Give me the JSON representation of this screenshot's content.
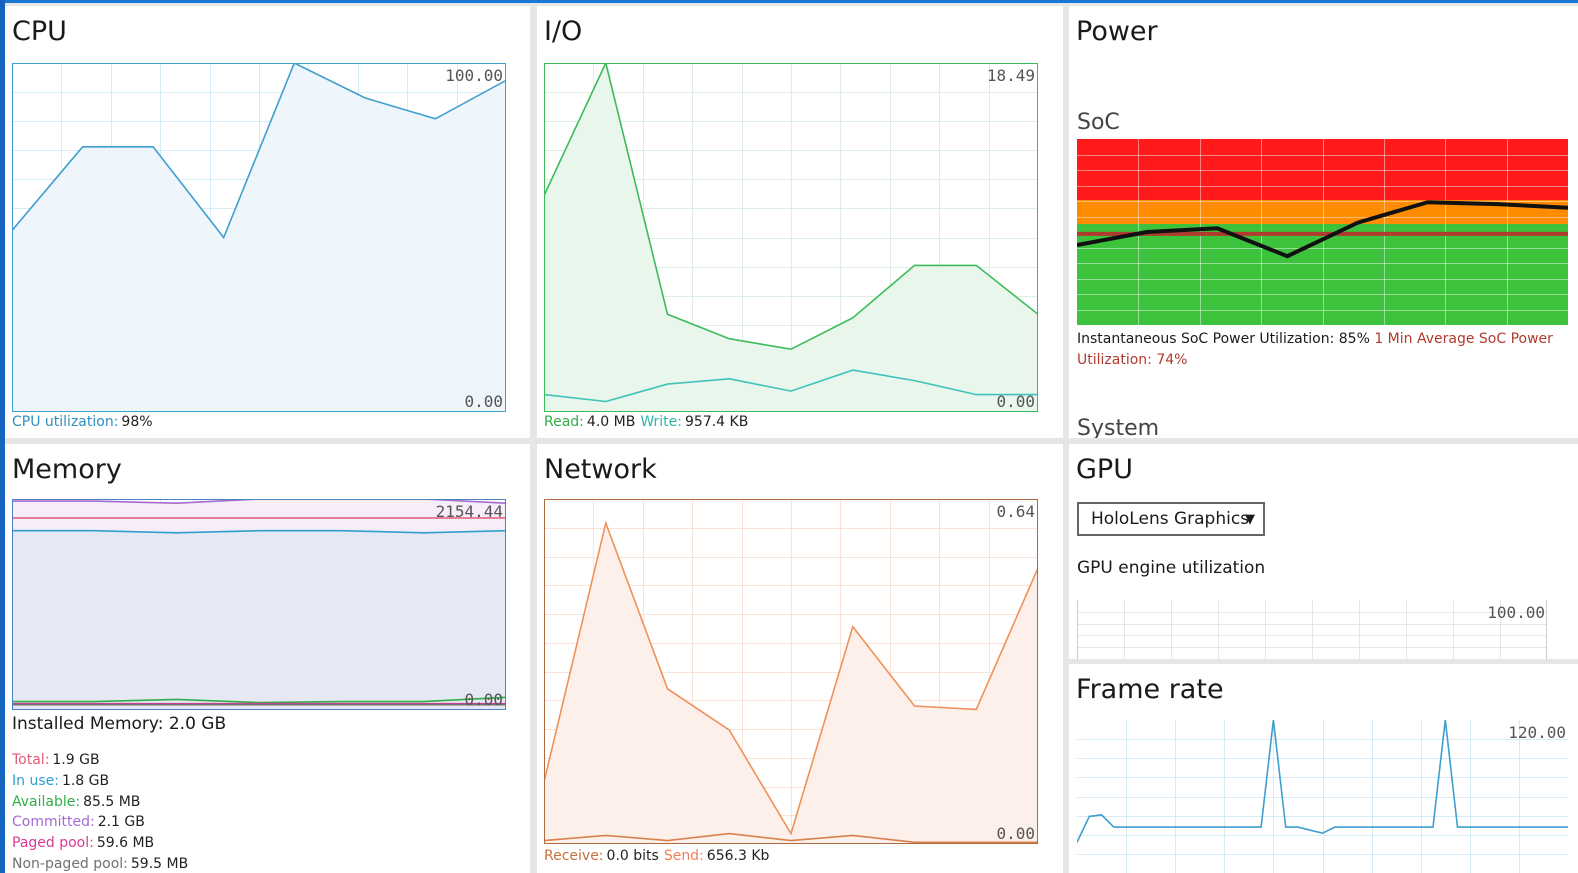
{
  "panels": {
    "cpu": {
      "title": "CPU",
      "max": "100.00",
      "min": "0.00",
      "legend_key": "CPU utilization:",
      "legend_value": "98%",
      "series": [
        {
          "name": "CPU utilization",
          "color": "#3f9fcf",
          "fill": "#eef5fb",
          "values": [
            52,
            76,
            76,
            50,
            100,
            90,
            84,
            95
          ]
        }
      ]
    },
    "io": {
      "title": "I/O",
      "max": "18.49",
      "min": "0.00",
      "read_key": "Read:",
      "read_value": "4.0 MB",
      "write_key": "Write:",
      "write_value": "957.4 KB",
      "series": [
        {
          "name": "Read",
          "color": "#3dbb5a",
          "fill": "#e8f6ec",
          "values": [
            62,
            100,
            28,
            21,
            18,
            27,
            42,
            42,
            28
          ]
        },
        {
          "name": "Write",
          "color": "#3fc3b9",
          "fill": "none",
          "values": [
            5,
            3,
            8,
            9.5,
            6,
            12,
            9,
            5,
            5
          ]
        }
      ]
    },
    "memory": {
      "title": "Memory",
      "max": "2154.44",
      "min": "0.00",
      "installed": "Installed Memory: 2.0 GB",
      "items": [
        {
          "key": "Total:",
          "value": "1.9 GB",
          "color": "#e05a78"
        },
        {
          "key": "In use:",
          "value": "1.8 GB",
          "color": "#2f9fcf"
        },
        {
          "key": "Available:",
          "value": "85.5 MB",
          "color": "#2fae4a"
        },
        {
          "key": "Committed:",
          "value": "2.1 GB",
          "color": "#a56bd1"
        },
        {
          "key": "Paged pool:",
          "value": "59.6 MB",
          "color": "#d63b93"
        },
        {
          "key": "Non-paged pool:",
          "value": "59.5 MB",
          "color": "#707070"
        }
      ],
      "series": [
        {
          "name": "Committed",
          "color": "#a56bd1",
          "values": [
            99,
            99,
            98,
            100,
            100,
            100,
            98
          ]
        },
        {
          "name": "Total",
          "color": "#e05a78",
          "values": [
            91,
            91,
            91,
            91,
            91,
            91,
            91
          ]
        },
        {
          "name": "In use",
          "color": "#2f9fcf",
          "values": [
            85,
            85,
            84,
            85,
            85,
            84,
            85
          ]
        },
        {
          "name": "Available",
          "color": "#2fae4a",
          "values": [
            4,
            4,
            5,
            3.5,
            4,
            4,
            6
          ]
        },
        {
          "name": "Paged pool",
          "color": "#d63b93",
          "values": [
            3,
            3,
            3,
            3,
            3,
            3,
            3
          ]
        },
        {
          "name": "Non-paged pool",
          "color": "#707070",
          "values": [
            2.5,
            2.5,
            2.5,
            2.5,
            2.5,
            2.5,
            2.5
          ]
        }
      ]
    },
    "network": {
      "title": "Network",
      "max": "0.64",
      "min": "0.00",
      "receive_key": "Receive:",
      "receive_value": "0.0 bits",
      "send_key": "Send:",
      "send_value": "656.3 Kb",
      "series": [
        {
          "name": "Send",
          "color": "#f0905a",
          "fill": "#fdf0ea",
          "values": [
            18,
            93,
            45,
            33,
            3,
            63,
            40,
            39,
            80
          ]
        },
        {
          "name": "Receive",
          "color": "#d9804f",
          "fill": "none",
          "values": [
            1,
            2.5,
            1,
            3,
            1,
            2.5,
            0.5,
            0.5,
            0.5
          ]
        }
      ]
    },
    "power": {
      "title": "Power",
      "soc_title": "SoC",
      "instant_text": "Instantaneous SoC Power Utilization: 85%",
      "avg_text": "1 Min Average SoC Power Utilization: 74%",
      "system_title": "System",
      "bands": {
        "red": "#ff1a1a",
        "orange": "#ff8c00",
        "green": "#3cc23c",
        "avg_line": "#b03a2e"
      },
      "series": [
        {
          "name": "SoC Power",
          "color": "#111111",
          "values": [
            43,
            50,
            52,
            37,
            55,
            66,
            65,
            63
          ]
        }
      ],
      "avg_value": 49
    },
    "gpu": {
      "title": "GPU",
      "selected": "HoloLens Graphics",
      "engine_title": "GPU engine utilization",
      "max": "100.00"
    },
    "frame_rate": {
      "title": "Frame rate",
      "max": "120.00",
      "series": [
        {
          "name": "Frame rate",
          "color": "#3f9fcf",
          "values": [
            20,
            37,
            38,
            30,
            30,
            30,
            30,
            30,
            30,
            30,
            30,
            30,
            30,
            30,
            30,
            30,
            100,
            30,
            30,
            28,
            26,
            30,
            30,
            30,
            30,
            30,
            30,
            30,
            30,
            30,
            100,
            30,
            30,
            30,
            30,
            30,
            30,
            30,
            30,
            30,
            30
          ]
        }
      ]
    }
  },
  "colors": {
    "cpu": "#3f9fcf",
    "io": "#3dbb5a",
    "io_write": "#3fc3b9",
    "memory_border": "#4a84c0",
    "network": "#c98c6a",
    "avg_text": "#b03a2e"
  }
}
